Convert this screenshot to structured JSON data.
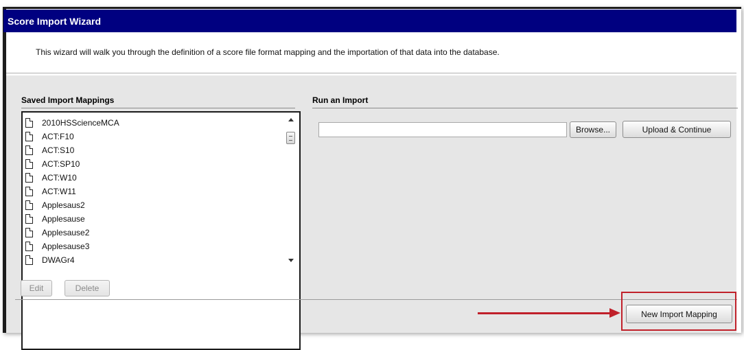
{
  "window": {
    "title": "Score Import Wizard"
  },
  "intro": {
    "text": "This wizard will walk you through the definition of a score file format mapping and the importation of that data into the database."
  },
  "saved_mappings": {
    "header": "Saved Import Mappings",
    "items": [
      "2010HSScienceMCA",
      "ACT:F10",
      "ACT:S10",
      "ACT:SP10",
      "ACT:W10",
      "ACT:W11",
      "Applesaus2",
      "Applesause",
      "Applesause2",
      "Applesause3",
      "DWAGr4"
    ],
    "item_icon": "document-icon",
    "edit_label": "Edit",
    "delete_label": "Delete"
  },
  "run_import": {
    "header": "Run an Import",
    "file_value": "",
    "browse_label": "Browse...",
    "upload_label": "Upload & Continue"
  },
  "footer": {
    "new_mapping_label": "New Import Mapping"
  },
  "colors": {
    "titlebar": "#000080",
    "annotation": "#c0202a",
    "panel_bg": "#e6e6e6"
  }
}
